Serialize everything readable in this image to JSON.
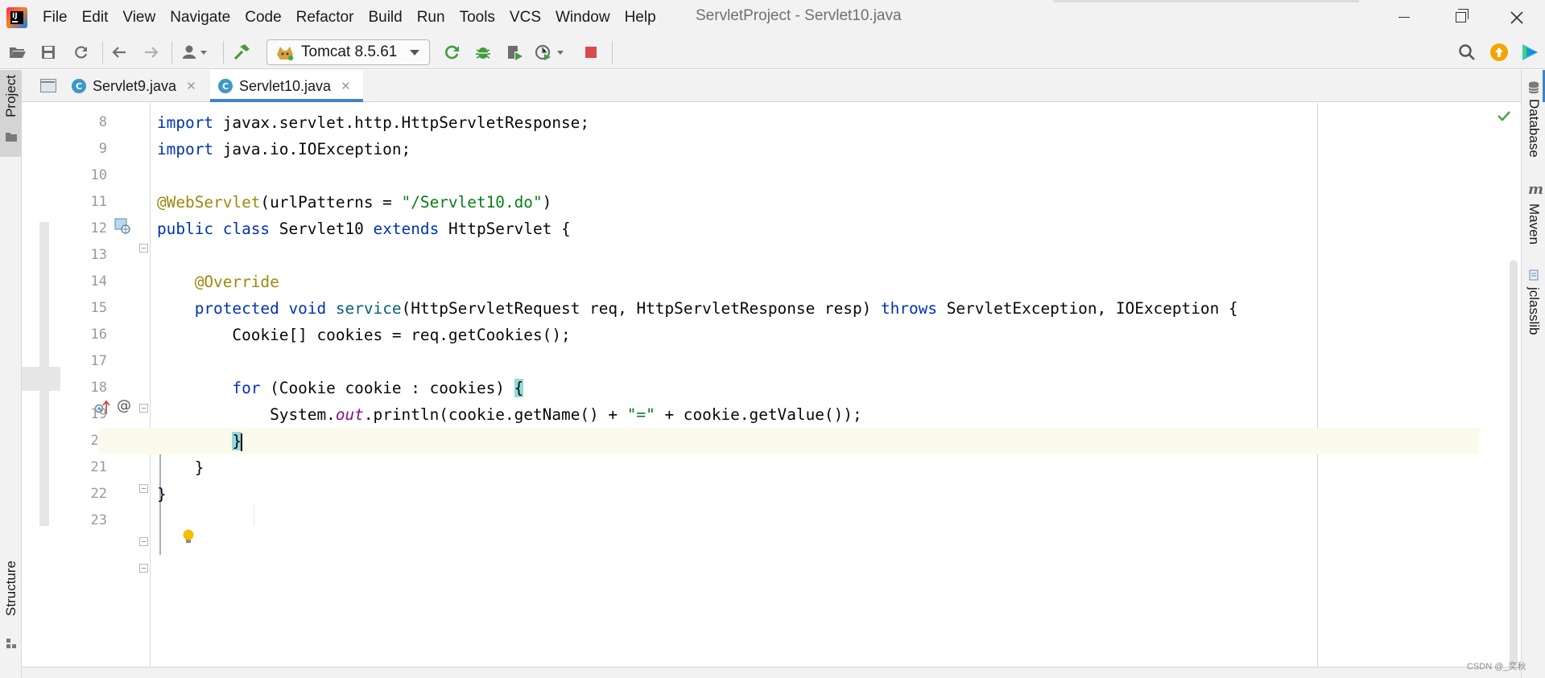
{
  "window": {
    "title": "ServletProject - Servlet10.java"
  },
  "menu": [
    {
      "label": "File"
    },
    {
      "label": "Edit"
    },
    {
      "label": "View"
    },
    {
      "label": "Navigate"
    },
    {
      "label": "Code"
    },
    {
      "label": "Refactor"
    },
    {
      "label": "Build"
    },
    {
      "label": "Run"
    },
    {
      "label": "Tools"
    },
    {
      "label": "VCS"
    },
    {
      "label": "Window"
    },
    {
      "label": "Help"
    }
  ],
  "toolbar": {
    "run_config": "Tomcat 8.5.61",
    "icons": [
      "open-folder-icon",
      "save-icon",
      "sync-icon",
      "back-icon",
      "forward-icon",
      "user-icon",
      "build-hammer-icon",
      "rerun-icon",
      "debug-icon",
      "coverage-icon",
      "profile-icon",
      "stop-icon",
      "search-icon",
      "update-icon",
      "toolbox-icon"
    ]
  },
  "left_strip": {
    "project_label": "Project",
    "structure_label": "Structure"
  },
  "right_strip": {
    "database_label": "Database",
    "maven_label": "Maven",
    "jclasslib_label": "jclasslib"
  },
  "tabs": [
    {
      "name": "Servlet9.java",
      "active": false
    },
    {
      "name": "Servlet10.java",
      "active": true
    }
  ],
  "editor": {
    "current_line": 20,
    "lines": [
      {
        "num": "8"
      },
      {
        "num": "9"
      },
      {
        "num": "10"
      },
      {
        "num": "11"
      },
      {
        "num": "12"
      },
      {
        "num": "13"
      },
      {
        "num": "14"
      },
      {
        "num": "15"
      },
      {
        "num": "16"
      },
      {
        "num": "17"
      },
      {
        "num": "18"
      },
      {
        "num": "19"
      },
      {
        "num": "20"
      },
      {
        "num": "21"
      },
      {
        "num": "22"
      },
      {
        "num": "23"
      }
    ],
    "code": {
      "l8_kw": "import",
      "l8_rest": " javax.servlet.http.HttpServletResponse;",
      "l9_kw": "import",
      "l9_rest": " java.io.IOException;",
      "l11_ann": "@WebServlet",
      "l11_a": "(urlPatterns = ",
      "l11_str": "\"/Servlet10.do\"",
      "l11_b": ")",
      "l12_kw1": "public",
      "l12_kw2": "class",
      "l12_name": " Servlet10 ",
      "l12_kw3": "extends",
      "l12_rest": " HttpServlet {",
      "l14_ann": "@Override",
      "l15_kw1": "protected",
      "l15_kw2": "void",
      "l15_fn": "service",
      "l15_a": "(HttpServletRequest req, HttpServletResponse resp) ",
      "l15_kw3": "throws",
      "l15_b": " ServletException, IOException {",
      "l16": "Cookie[] cookies = req.getCookies();",
      "l18_kw": "for",
      "l18_a": " (Cookie cookie : cookies) ",
      "l18_brace": "{",
      "l19_a": "System.",
      "l19_fld": "out",
      "l19_b": ".println(cookie.getName() + ",
      "l19_str": "\"=\"",
      "l19_c": " + cookie.getValue());",
      "l20": "}",
      "l21": "}",
      "l22": "}"
    }
  },
  "watermark": "CSDN @_奕秋"
}
